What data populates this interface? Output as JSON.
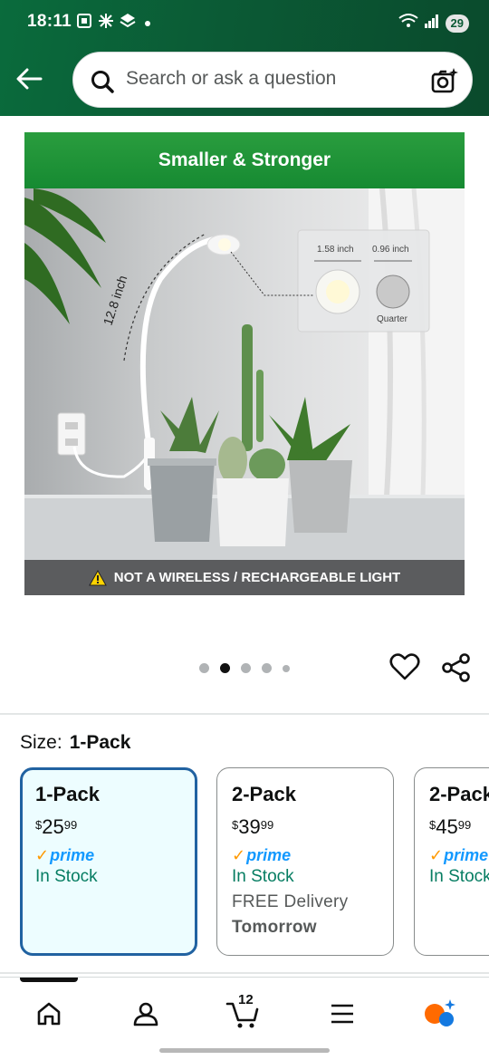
{
  "status_bar": {
    "time": "18:11",
    "battery": "29"
  },
  "search": {
    "placeholder": "Search or ask a question"
  },
  "product_image": {
    "banner": "Smaller & Stronger",
    "height_label": "12.8 inch",
    "inset_size_1": "1.58 inch",
    "inset_size_2": "0.96 inch",
    "inset_caption": "Quarter",
    "warning": "NOT A WIRELESS / RECHARGEABLE LIGHT",
    "image_count": 5,
    "active_index": 1
  },
  "size": {
    "label": "Size:",
    "selected": "1-Pack"
  },
  "options": [
    {
      "title": "1-Pack",
      "currency": "$",
      "dollars": "25",
      "cents": "99",
      "prime": "prime",
      "stock": "In Stock",
      "delivery": "",
      "delivery_day": ""
    },
    {
      "title": "2-Pack",
      "currency": "$",
      "dollars": "39",
      "cents": "99",
      "prime": "prime",
      "stock": "In Stock",
      "delivery": "FREE Delivery",
      "delivery_day": "Tomorrow"
    },
    {
      "title": "2-Pack",
      "currency": "$",
      "dollars": "45",
      "cents": "99",
      "prime": "prime",
      "stock": "In Stock",
      "delivery": "",
      "delivery_day": ""
    }
  ],
  "nav": {
    "cart_count": "12"
  },
  "colors": {
    "header": "#0b5a35",
    "selected_border": "#2162a1",
    "prime": "#1399ff",
    "in_stock": "#067d62"
  }
}
